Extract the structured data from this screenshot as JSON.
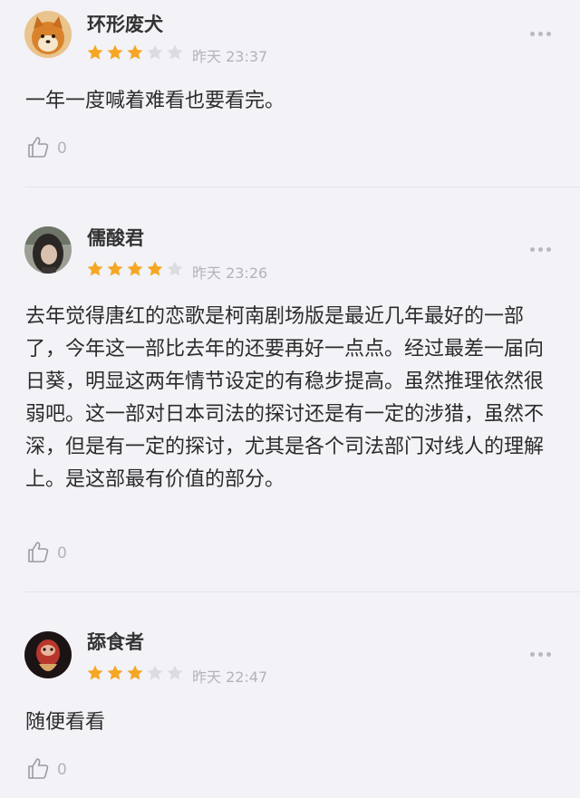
{
  "colors": {
    "star_on": "#f5a623",
    "star_off": "#dcdce0",
    "meta_text": "#b3b3b8",
    "background": "#f2f2f7"
  },
  "reviews": [
    {
      "username": "环形废犬",
      "rating": 3,
      "max_rating": 5,
      "time": "昨天 23:37",
      "text": "一年一度喊着难看也要看完。",
      "likes": "0",
      "avatar_icon": "shiba-dog-avatar"
    },
    {
      "username": "儒酸君",
      "rating": 4,
      "max_rating": 5,
      "time": "昨天 23:26",
      "text": "去年觉得唐红的恋歌是柯南剧场版是最近几年最好的一部了，今年这一部比去年的还要再好一点点。经过最差一届向日葵，明显这两年情节设定的有稳步提高。虽然推理依然很弱吧。这一部对日本司法的探讨还是有一定的涉猎，虽然不深，但是有一定的探讨，尤其是各个司法部门对线人的理解上。是这部最有价值的部分。",
      "likes": "0",
      "avatar_icon": "person-photo-avatar"
    },
    {
      "username": "舔食者",
      "rating": 3,
      "max_rating": 5,
      "time": "昨天 22:47",
      "text": "随便看看",
      "likes": "0",
      "avatar_icon": "creature-avatar"
    }
  ]
}
